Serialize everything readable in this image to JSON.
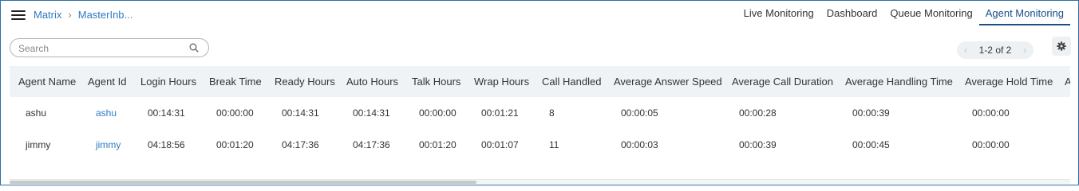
{
  "breadcrumb": {
    "items": [
      "Matrix",
      "MasterInb..."
    ]
  },
  "topnav": {
    "tabs": [
      "Live Monitoring",
      "Dashboard",
      "Queue Monitoring",
      "Agent Monitoring"
    ],
    "active": "Agent Monitoring"
  },
  "search": {
    "placeholder": "Search",
    "value": ""
  },
  "pager": {
    "text": "1-2 of 2"
  },
  "icons": {
    "menu": "hamburger-icon",
    "search": "search-icon",
    "settings": "gear-icon",
    "prev": "chevron-left-icon",
    "next": "chevron-right-icon"
  },
  "table": {
    "columns": [
      "Agent Name",
      "Agent Id",
      "Login Hours",
      "Break Time",
      "Ready Hours",
      "Auto Hours",
      "Talk Hours",
      "Wrap Hours",
      "Call Handled",
      "Average Answer Speed",
      "Average Call Duration",
      "Average Handling Time",
      "Average Hold Time",
      "A"
    ],
    "rows": [
      [
        "ashu",
        "ashu",
        "00:14:31",
        "00:00:00",
        "00:14:31",
        "00:14:31",
        "00:00:00",
        "00:01:21",
        "8",
        "00:00:05",
        "00:00:28",
        "00:00:39",
        "00:00:00"
      ],
      [
        "jimmy",
        "jimmy",
        "04:18:56",
        "00:01:20",
        "04:17:36",
        "04:17:36",
        "00:01:20",
        "00:01:07",
        "11",
        "00:00:03",
        "00:00:39",
        "00:00:45",
        "00:00:00"
      ]
    ]
  },
  "colors": {
    "accent": "#2f7ac0",
    "active_tab": "#1f4f80",
    "header_bg": "#f0f3f6"
  }
}
